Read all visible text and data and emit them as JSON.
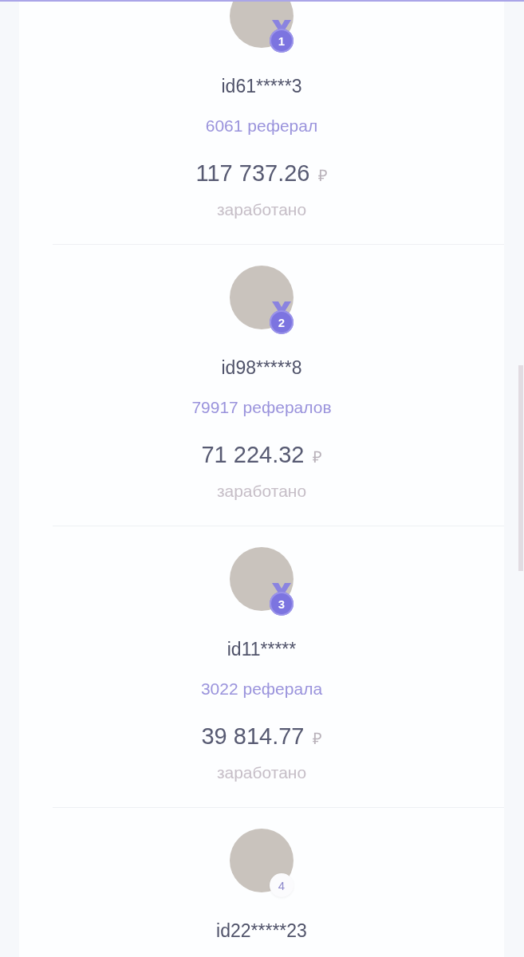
{
  "leaders": [
    {
      "rank": "1",
      "kind": "medal",
      "user_id": "id61*****3",
      "referrals": "6061 реферал",
      "amount": "117 737.26",
      "currency": "₽",
      "amount_label": "заработано"
    },
    {
      "rank": "2",
      "kind": "medal",
      "user_id": "id98*****8",
      "referrals": "79917 рефералов",
      "amount": "71 224.32",
      "currency": "₽",
      "amount_label": "заработано"
    },
    {
      "rank": "3",
      "kind": "medal",
      "user_id": "id11*****",
      "referrals": "3022 реферала",
      "amount": "39 814.77",
      "currency": "₽",
      "amount_label": "заработано"
    },
    {
      "rank": "4",
      "kind": "plain",
      "user_id": "id22*****23"
    }
  ]
}
